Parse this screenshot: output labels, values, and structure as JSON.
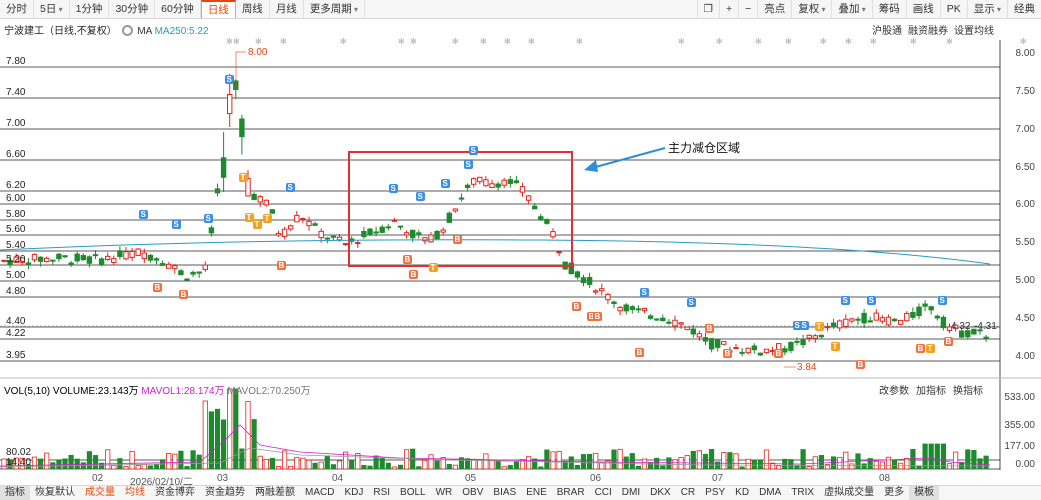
{
  "top_tabs": [
    {
      "label": "分时",
      "dd": false
    },
    {
      "label": "5日",
      "dd": true
    },
    {
      "label": "1分钟",
      "dd": false
    },
    {
      "label": "30分钟",
      "dd": false
    },
    {
      "label": "60分钟",
      "dd": false
    },
    {
      "label": "日线",
      "dd": false,
      "active": true
    },
    {
      "label": "周线",
      "dd": false
    },
    {
      "label": "月线",
      "dd": false
    },
    {
      "label": "更多周期",
      "dd": true
    }
  ],
  "right_tools": [
    {
      "label": "亮点",
      "dd": false
    },
    {
      "label": "复权",
      "dd": true
    },
    {
      "label": "叠加",
      "dd": true
    },
    {
      "label": "筹码",
      "dd": false
    },
    {
      "label": "画线",
      "dd": false
    },
    {
      "label": "PK",
      "dd": false
    },
    {
      "label": "显示",
      "dd": true
    },
    {
      "label": "经典",
      "dd": false
    }
  ],
  "info": {
    "title": "宁波建工（日线,不复权）",
    "ma_label": "MA",
    "ma250": "MA250:5.22"
  },
  "right_links": [
    "沪股通",
    "融资融券",
    "设置均线"
  ],
  "y_left": [
    "7.80",
    "7.40",
    "7.00",
    "6.60",
    "6.20",
    "6.00",
    "5.80",
    "5.60",
    "5.40",
    "5.20",
    "5.00",
    "4.80",
    "4.40",
    "4.22",
    "3.95"
  ],
  "y_right": [
    "8.00",
    "7.50",
    "7.00",
    "6.50",
    "6.00",
    "5.50",
    "5.00",
    "4.50",
    "4.00"
  ],
  "annotations": {
    "high": "8.00",
    "low": "3.84",
    "last_left": "4.32",
    "last_right": "4.31",
    "region_label": "主力减仓区域"
  },
  "vol_info": {
    "name": "VOL(5,10)",
    "volume": "VOLUME:23.143万",
    "mavol1": "MAVOL1:28.174万",
    "mavol2": "MAVOL2:70.250万"
  },
  "vol_tools": [
    "改参数",
    "加指标",
    "换指标"
  ],
  "vol_left": [
    "80.02",
    "14.40"
  ],
  "vol_right": [
    "533.00",
    "355.00",
    "177.00",
    "0.00"
  ],
  "x_labels": [
    "02",
    "2026/02/10/二",
    "03",
    "04",
    "05",
    "06",
    "07",
    "08"
  ],
  "bottom_tabs": [
    "指标",
    "恢复默认",
    "成交量",
    "均线",
    "资金博弈",
    "资金趋势",
    "两融差额",
    "MACD",
    "KDJ",
    "RSI",
    "BOLL",
    "WR",
    "OBV",
    "BIAS",
    "ENE",
    "BRAR",
    "CCI",
    "DMI",
    "DKX",
    "CR",
    "PSY",
    "KD",
    "DMA",
    "TRIX",
    "虚拟成交量",
    "更多",
    "模板"
  ],
  "colors": {
    "up": "#e8221c",
    "down": "#1e8a2e",
    "ma": "#2a9bc1",
    "accent": "#e8450c",
    "box": "#e03030",
    "arrow": "#2a8fd8"
  }
}
